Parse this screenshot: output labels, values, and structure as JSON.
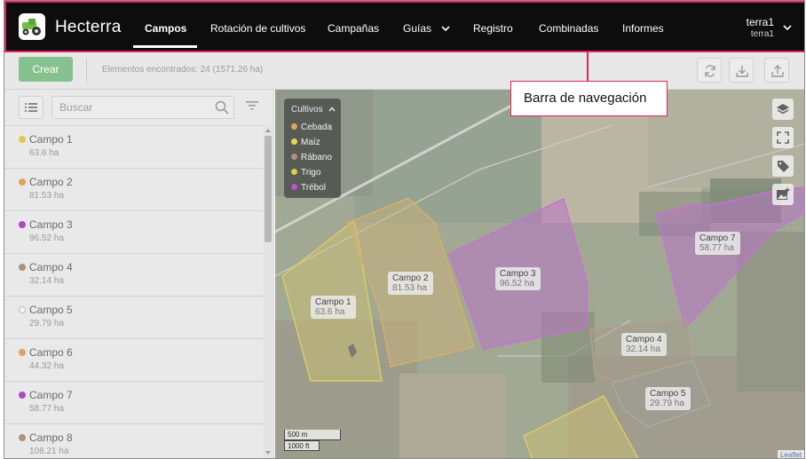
{
  "app": {
    "title": "Hecterra"
  },
  "nav": {
    "items": [
      {
        "label": "Campos",
        "active": true
      },
      {
        "label": "Rotación de cultivos"
      },
      {
        "label": "Campañas"
      },
      {
        "label": "Guías"
      },
      {
        "label": "Registro"
      },
      {
        "label": "Combinadas"
      },
      {
        "label": "Informes"
      }
    ],
    "user": {
      "name": "terra1",
      "account": "terra1"
    }
  },
  "callout": {
    "text": "Barra de navegación"
  },
  "toolbar": {
    "create_label": "Crear",
    "found_text": "Elementos encontrados: 24 (1571.26 ha)",
    "icons": [
      "refresh-icon",
      "download-icon",
      "upload-icon"
    ]
  },
  "sidebar": {
    "search_placeholder": "Buscar",
    "fields": [
      {
        "name": "Campo 1",
        "area": "63.6 ha",
        "color": "#e3c94d"
      },
      {
        "name": "Campo 2",
        "area": "81.53 ha",
        "color": "#e0a35a"
      },
      {
        "name": "Campo 3",
        "area": "96.52 ha",
        "color": "#b444c8"
      },
      {
        "name": "Campo 4",
        "area": "32.14 ha",
        "color": "#b0917a"
      },
      {
        "name": "Campo 5",
        "area": "29.79 ha",
        "color": "none"
      },
      {
        "name": "Campo 6",
        "area": "44.32 ha",
        "color": "#e0a35a"
      },
      {
        "name": "Campo 7",
        "area": "58.77 ha",
        "color": "#b444c8"
      },
      {
        "name": "Campo 8",
        "area": "108.21 ha",
        "color": "#b0917a"
      }
    ]
  },
  "map": {
    "legend": {
      "title": "Cultivos",
      "items": [
        {
          "label": "Cebada",
          "color": "#e0a35a"
        },
        {
          "label": "Maíz",
          "color": "#e3d94d"
        },
        {
          "label": "Rábano",
          "color": "#b0917a"
        },
        {
          "label": "Trigo",
          "color": "#e3c94d"
        },
        {
          "label": "Trébol",
          "color": "#c84ad8"
        }
      ]
    },
    "field_labels": [
      {
        "name": "Campo 1",
        "area": "63.6 ha"
      },
      {
        "name": "Campo 2",
        "area": "81.53 ha"
      },
      {
        "name": "Campo 3",
        "area": "96.52 ha"
      },
      {
        "name": "Campo 4",
        "area": "32.14 ha"
      },
      {
        "name": "Campo 5",
        "area": "29.79 ha"
      },
      {
        "name": "Campo 7",
        "area": "58.77 ha"
      }
    ],
    "scale": {
      "metric": "500 m",
      "imperial": "1000 ft"
    },
    "attribution": "Leaflet",
    "controls": [
      "layers-icon",
      "fullscreen-icon",
      "tag-icon",
      "add-image-icon"
    ]
  }
}
